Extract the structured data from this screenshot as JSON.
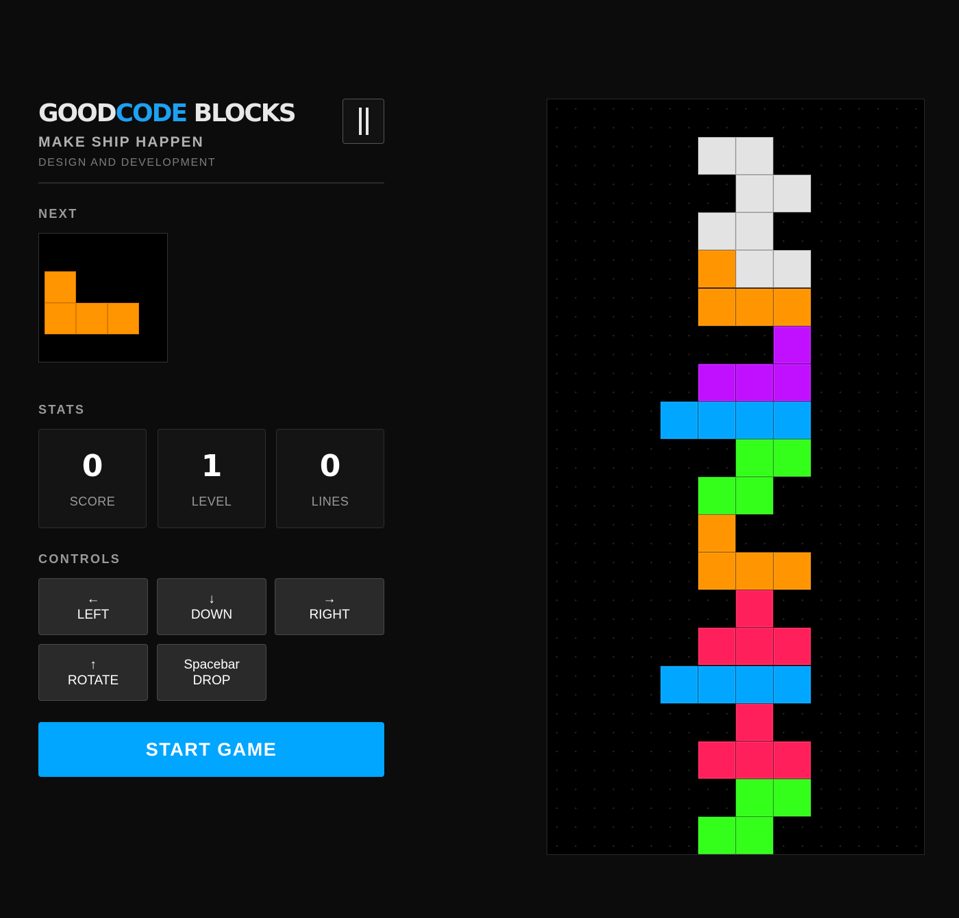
{
  "header": {
    "title_part1": "GOOD",
    "title_part2": "CODE",
    "title_part3": " BLOCKS",
    "tagline": "MAKE SHIP HAPPEN",
    "subtagline": "DESIGN AND DEVELOPMENT",
    "pause_icon": "pause-icon"
  },
  "next": {
    "label": "NEXT",
    "piece": "L",
    "color": "#ff9500"
  },
  "stats": {
    "label": "STATS",
    "items": [
      {
        "value": "0",
        "label": "SCORE"
      },
      {
        "value": "1",
        "label": "LEVEL"
      },
      {
        "value": "0",
        "label": "LINES"
      }
    ]
  },
  "controls": {
    "label": "CONTROLS",
    "buttons": [
      {
        "key": "←",
        "action": "LEFT"
      },
      {
        "key": "↓",
        "action": "DOWN"
      },
      {
        "key": "→",
        "action": "RIGHT"
      },
      {
        "key": "↑",
        "action": "ROTATE"
      },
      {
        "key": "Spacebar",
        "action": "DROP"
      }
    ]
  },
  "start_button": "START GAME",
  "colors": {
    "accent": "#00a6ff",
    "brand_blue": "#1da1f2",
    "white_piece": "#e3e3e3",
    "orange_piece": "#ff9500",
    "purple_piece": "#c010ff",
    "cyan_piece": "#00a6ff",
    "green_piece": "#33ff1a",
    "red_piece": "#ff1f5a"
  },
  "board": {
    "cols": 10,
    "rows": 20,
    "cells": [
      {
        "row": 1,
        "col": 4,
        "color": "#e3e3e3"
      },
      {
        "row": 1,
        "col": 5,
        "color": "#e3e3e3"
      },
      {
        "row": 2,
        "col": 5,
        "color": "#e3e3e3"
      },
      {
        "row": 2,
        "col": 6,
        "color": "#e3e3e3"
      },
      {
        "row": 3,
        "col": 4,
        "color": "#e3e3e3"
      },
      {
        "row": 3,
        "col": 5,
        "color": "#e3e3e3"
      },
      {
        "row": 4,
        "col": 4,
        "color": "#ff9500"
      },
      {
        "row": 4,
        "col": 5,
        "color": "#e3e3e3"
      },
      {
        "row": 4,
        "col": 6,
        "color": "#e3e3e3"
      },
      {
        "row": 5,
        "col": 4,
        "color": "#ff9500"
      },
      {
        "row": 5,
        "col": 5,
        "color": "#ff9500"
      },
      {
        "row": 5,
        "col": 6,
        "color": "#ff9500"
      },
      {
        "row": 6,
        "col": 6,
        "color": "#c010ff"
      },
      {
        "row": 7,
        "col": 4,
        "color": "#c010ff"
      },
      {
        "row": 7,
        "col": 5,
        "color": "#c010ff"
      },
      {
        "row": 7,
        "col": 6,
        "color": "#c010ff"
      },
      {
        "row": 8,
        "col": 3,
        "color": "#00a6ff"
      },
      {
        "row": 8,
        "col": 4,
        "color": "#00a6ff"
      },
      {
        "row": 8,
        "col": 5,
        "color": "#00a6ff"
      },
      {
        "row": 8,
        "col": 6,
        "color": "#00a6ff"
      },
      {
        "row": 9,
        "col": 5,
        "color": "#33ff1a"
      },
      {
        "row": 9,
        "col": 6,
        "color": "#33ff1a"
      },
      {
        "row": 10,
        "col": 4,
        "color": "#33ff1a"
      },
      {
        "row": 10,
        "col": 5,
        "color": "#33ff1a"
      },
      {
        "row": 11,
        "col": 4,
        "color": "#ff9500"
      },
      {
        "row": 12,
        "col": 4,
        "color": "#ff9500"
      },
      {
        "row": 12,
        "col": 5,
        "color": "#ff9500"
      },
      {
        "row": 12,
        "col": 6,
        "color": "#ff9500"
      },
      {
        "row": 13,
        "col": 5,
        "color": "#ff1f5a"
      },
      {
        "row": 14,
        "col": 4,
        "color": "#ff1f5a"
      },
      {
        "row": 14,
        "col": 5,
        "color": "#ff1f5a"
      },
      {
        "row": 14,
        "col": 6,
        "color": "#ff1f5a"
      },
      {
        "row": 15,
        "col": 3,
        "color": "#00a6ff"
      },
      {
        "row": 15,
        "col": 4,
        "color": "#00a6ff"
      },
      {
        "row": 15,
        "col": 5,
        "color": "#00a6ff"
      },
      {
        "row": 15,
        "col": 6,
        "color": "#00a6ff"
      },
      {
        "row": 16,
        "col": 5,
        "color": "#ff1f5a"
      },
      {
        "row": 17,
        "col": 4,
        "color": "#ff1f5a"
      },
      {
        "row": 17,
        "col": 5,
        "color": "#ff1f5a"
      },
      {
        "row": 17,
        "col": 6,
        "color": "#ff1f5a"
      },
      {
        "row": 18,
        "col": 5,
        "color": "#33ff1a"
      },
      {
        "row": 18,
        "col": 6,
        "color": "#33ff1a"
      },
      {
        "row": 19,
        "col": 4,
        "color": "#33ff1a"
      },
      {
        "row": 19,
        "col": 5,
        "color": "#33ff1a"
      }
    ]
  }
}
